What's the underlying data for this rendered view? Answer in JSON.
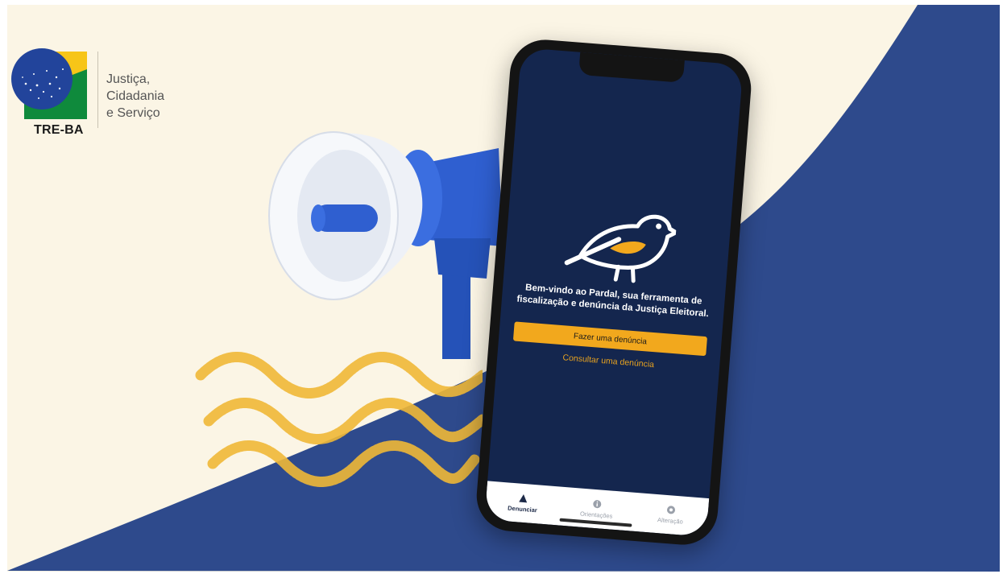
{
  "logo": {
    "abbr": "TRE-BA",
    "tagline": [
      "Justiça,",
      "Cidadania",
      "e Serviço"
    ],
    "emblem_icon": "brazil-globe-emblem"
  },
  "app": {
    "welcome_text": "Bem-vindo ao Pardal, sua ferramenta de fiscalização e denúncia da Justiça Eleitoral.",
    "primary_button_label": "Fazer uma denúncia",
    "secondary_link_label": "Consultar uma denúncia",
    "brand_icon": "pardal-bird-icon",
    "tabs": [
      {
        "label": "Denunciar",
        "icon": "warning-triangle-icon",
        "active": true
      },
      {
        "label": "Orientações",
        "icon": "info-circle-icon",
        "active": false
      },
      {
        "label": "Alteração",
        "icon": "settings-circle-icon",
        "active": false
      }
    ]
  },
  "colors": {
    "background_cream": "#fbf5e5",
    "background_navy": "#2e4a8c",
    "app_navy": "#14264e",
    "accent_yellow": "#f2a81d",
    "megaphone_blue": "#2f5fd0",
    "emblem_green": "#0f8a3c",
    "emblem_yellow": "#f7c518"
  }
}
